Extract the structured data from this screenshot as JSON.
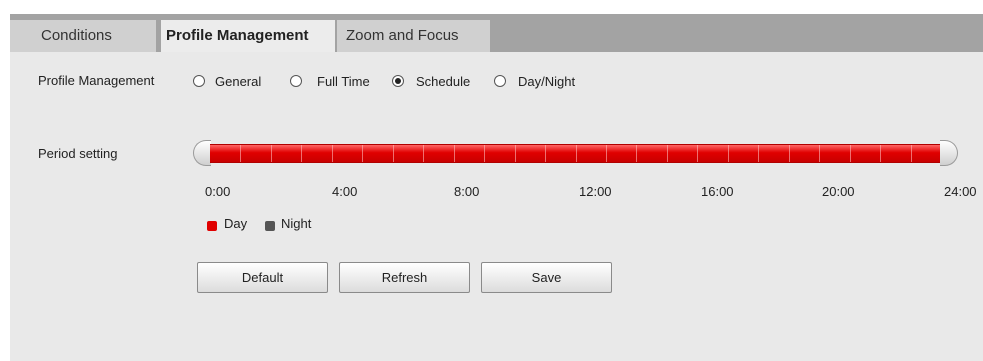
{
  "tabs": [
    {
      "label": "Conditions",
      "active": false
    },
    {
      "label": "Profile Management",
      "active": true
    },
    {
      "label": "Zoom and Focus",
      "active": false
    }
  ],
  "profile": {
    "label": "Profile Management",
    "options": [
      "General",
      "Full Time",
      "Schedule",
      "Day/Night"
    ],
    "selected": "Schedule"
  },
  "period": {
    "label": "Period setting",
    "ticks": [
      "0:00",
      "4:00",
      "8:00",
      "12:00",
      "16:00",
      "20:00",
      "24:00"
    ],
    "schedule": [
      {
        "start": "0:00",
        "end": "24:00",
        "mode": "Day"
      }
    ]
  },
  "legend": [
    {
      "label": "Day",
      "color": "#e00000"
    },
    {
      "label": "Night",
      "color": "#555555"
    }
  ],
  "buttons": {
    "default": "Default",
    "refresh": "Refresh",
    "save": "Save"
  },
  "colors": {
    "day": "#e00000",
    "night": "#555555",
    "tabbar": "#a3a3a3",
    "panel": "#e9e9e9"
  }
}
